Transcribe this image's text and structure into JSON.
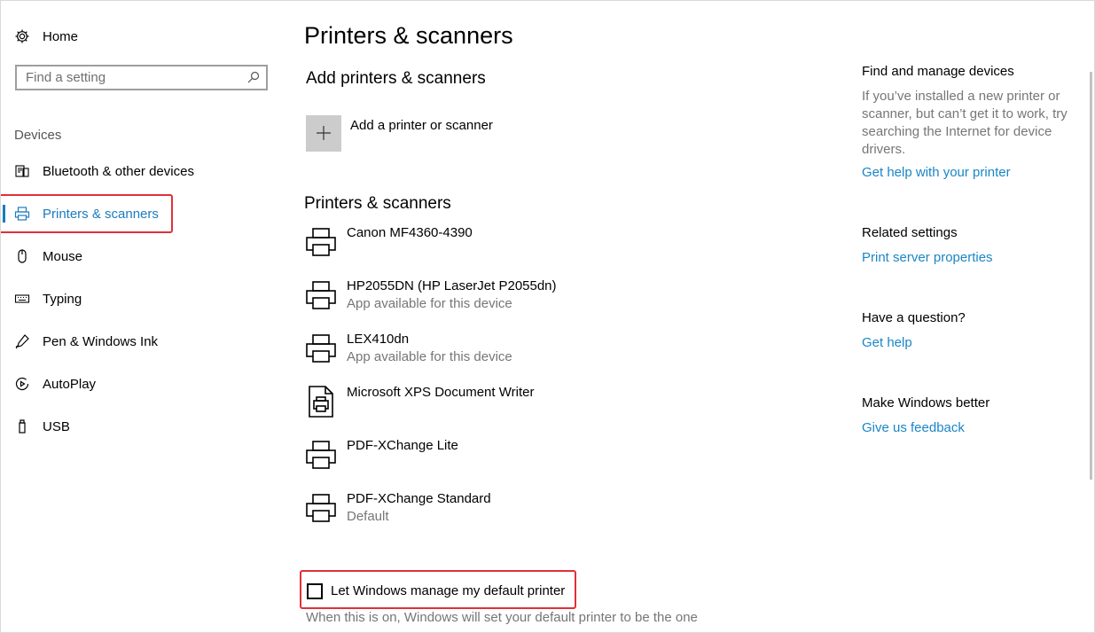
{
  "sidebar": {
    "home_label": "Home",
    "search_placeholder": "Find a setting",
    "section_label": "Devices",
    "items": [
      {
        "label": "Bluetooth & other devices",
        "icon": "bluetooth-devices-icon"
      },
      {
        "label": "Printers & scanners",
        "icon": "printer-icon",
        "active": true
      },
      {
        "label": "Mouse",
        "icon": "mouse-icon"
      },
      {
        "label": "Typing",
        "icon": "keyboard-icon"
      },
      {
        "label": "Pen & Windows Ink",
        "icon": "pen-icon"
      },
      {
        "label": "AutoPlay",
        "icon": "autoplay-icon"
      },
      {
        "label": "USB",
        "icon": "usb-icon"
      }
    ]
  },
  "main": {
    "title": "Printers & scanners",
    "add_section_title": "Add printers & scanners",
    "add_button_label": "Add a printer or scanner",
    "list_title": "Printers & scanners",
    "printers": [
      {
        "name": "Canon MF4360-4390",
        "sub": ""
      },
      {
        "name": "HP2055DN (HP LaserJet P2055dn)",
        "sub": "App available for this device"
      },
      {
        "name": "LEX410dn",
        "sub": "App available for this device"
      },
      {
        "name": "Microsoft XPS Document Writer",
        "sub": ""
      },
      {
        "name": "PDF-XChange Lite",
        "sub": ""
      },
      {
        "name": "PDF-XChange Standard",
        "sub": "Default"
      }
    ],
    "default_checkbox_label": "Let Windows manage my default printer",
    "default_checkbox_checked": false,
    "default_description": "When this is on, Windows will set your default printer to be the one"
  },
  "right": {
    "find_title": "Find and manage devices",
    "find_text": "If you’ve installed a new printer or scanner, but can’t get it to work, try searching the Internet for device drivers.",
    "find_link": "Get help with your printer",
    "related_title": "Related settings",
    "related_link": "Print server properties",
    "question_title": "Have a question?",
    "question_link": "Get help",
    "better_title": "Make Windows better",
    "better_link": "Give us feedback"
  },
  "colors": {
    "accent": "#1a7bbf",
    "highlight_box": "#e0303a"
  }
}
